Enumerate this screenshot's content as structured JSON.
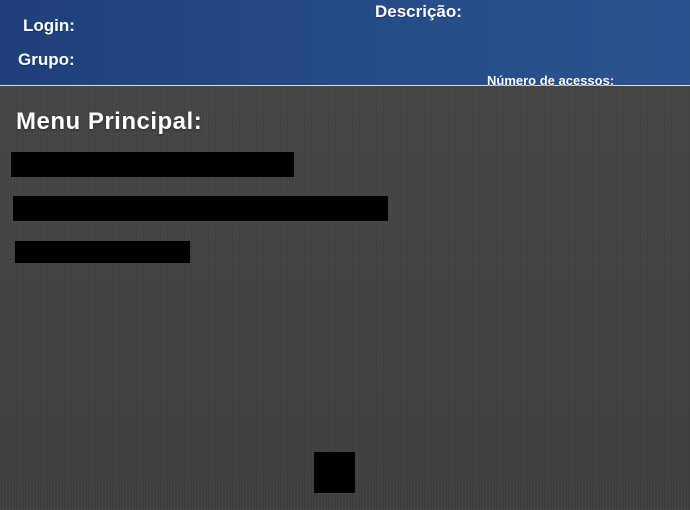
{
  "header": {
    "login_label": "Login:",
    "grupo_label": "Grupo:",
    "descricao_label": "Descrição:",
    "acessos_label": "Número de acessos:"
  },
  "menu": {
    "title": "Menu Principal:",
    "items_redacted": 3
  },
  "colors": {
    "header_bg": "#254b88",
    "body_bg": "#434343",
    "redaction": "#000000"
  }
}
